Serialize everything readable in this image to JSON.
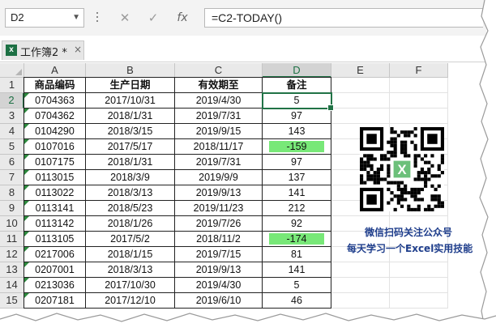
{
  "formula_bar": {
    "name_box": "D2",
    "cancel_icon": "close-icon",
    "enter_icon": "checkmark-icon",
    "function_icon_label": "fx",
    "formula": "=C2-TODAY()"
  },
  "workbook_tab": {
    "label": "工作簿2 *",
    "close_label": "×"
  },
  "columns": [
    "A",
    "B",
    "C",
    "D",
    "E",
    "F"
  ],
  "selected_cell": "D2",
  "rows": [
    {
      "num": "1",
      "cells": [
        "商品编码",
        "生产日期",
        "有效期至",
        "备注"
      ],
      "header": true
    },
    {
      "num": "2",
      "cells": [
        "0704363",
        "2017/10/31",
        "2019/4/30",
        "5"
      ],
      "triangle": true
    },
    {
      "num": "3",
      "cells": [
        "0704362",
        "2018/1/31",
        "2019/7/31",
        "97"
      ],
      "triangle": true
    },
    {
      "num": "4",
      "cells": [
        "0104290",
        "2018/3/15",
        "2019/9/15",
        "143"
      ],
      "triangle": true
    },
    {
      "num": "5",
      "cells": [
        "0107016",
        "2017/5/17",
        "2018/11/17",
        "-159"
      ],
      "triangle": true,
      "highlight": true
    },
    {
      "num": "6",
      "cells": [
        "0107175",
        "2018/1/31",
        "2019/7/31",
        "97"
      ],
      "triangle": true
    },
    {
      "num": "7",
      "cells": [
        "0113015",
        "2018/3/9",
        "2019/9/9",
        "137"
      ],
      "triangle": true
    },
    {
      "num": "8",
      "cells": [
        "0113022",
        "2018/3/13",
        "2019/9/13",
        "141"
      ],
      "triangle": true
    },
    {
      "num": "9",
      "cells": [
        "0113141",
        "2018/5/23",
        "2019/11/23",
        "212"
      ],
      "triangle": true
    },
    {
      "num": "10",
      "cells": [
        "0113142",
        "2018/1/26",
        "2019/7/26",
        "92"
      ],
      "triangle": true
    },
    {
      "num": "11",
      "cells": [
        "0113105",
        "2017/5/2",
        "2018/11/2",
        "-174"
      ],
      "triangle": true,
      "highlight": true
    },
    {
      "num": "12",
      "cells": [
        "0217006",
        "2018/1/15",
        "2019/7/15",
        "81"
      ],
      "triangle": true
    },
    {
      "num": "13",
      "cells": [
        "0207001",
        "2018/3/13",
        "2019/9/13",
        "141"
      ],
      "triangle": true
    },
    {
      "num": "14",
      "cells": [
        "0213036",
        "2017/10/30",
        "2019/4/30",
        "5"
      ],
      "triangle": true
    },
    {
      "num": "15",
      "cells": [
        "0207181",
        "2017/12/10",
        "2019/6/10",
        "46"
      ],
      "triangle": true
    }
  ],
  "highlight_color": "#78e878",
  "accent_color": "#217346",
  "qr_caption": {
    "line1": "微信扫码关注公众号",
    "line2": "每天学习一个Excel实用技能"
  }
}
